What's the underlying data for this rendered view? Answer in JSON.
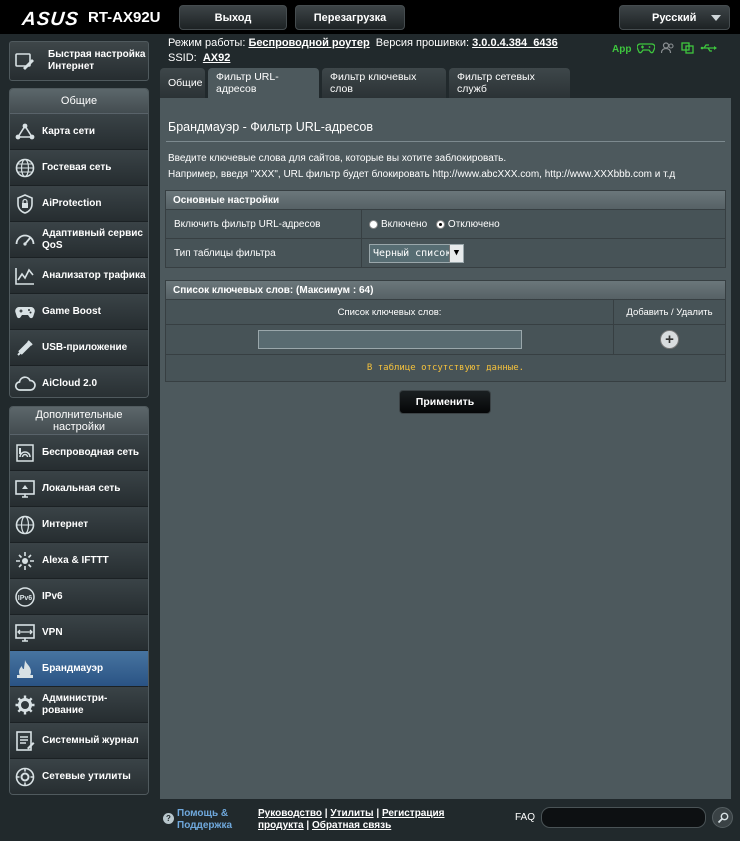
{
  "header": {
    "brand": "ASUS",
    "model": "RT-AX92U",
    "logout_label": "Выход",
    "reboot_label": "Перезагрузка",
    "language": "Русский"
  },
  "info": {
    "mode_label": "Режим работы:",
    "mode_value": "Беспроводной роутер",
    "firmware_label": "Версия прошивки:",
    "firmware_value": "3.0.0.4.384_6436",
    "ssid_label": "SSID:",
    "ssid_value": "AX92",
    "app_label": "App"
  },
  "sidebar": {
    "quick_setup": "Быстрая настройка Интернет",
    "general_header": "Общие",
    "general_items": [
      {
        "label": "Карта сети"
      },
      {
        "label": "Гостевая сеть"
      },
      {
        "label": "AiProtection"
      },
      {
        "label": "Адаптивный сервис QoS"
      },
      {
        "label": "Анализатор трафика"
      },
      {
        "label": "Game Boost"
      },
      {
        "label": "USB-приложение"
      },
      {
        "label": "AiCloud 2.0"
      }
    ],
    "advanced_header": "Дополнительные настройки",
    "advanced_items": [
      {
        "label": "Беспроводная сеть"
      },
      {
        "label": "Локальная сеть"
      },
      {
        "label": "Интернет"
      },
      {
        "label": "Alexa & IFTTT"
      },
      {
        "label": "IPv6"
      },
      {
        "label": "VPN"
      },
      {
        "label": "Брандмауэр"
      },
      {
        "label": "Администри-рование"
      },
      {
        "label": "Системный журнал"
      },
      {
        "label": "Сетевые утилиты"
      }
    ]
  },
  "tabs": [
    {
      "label": "Общие"
    },
    {
      "label": "Фильтр URL-адресов"
    },
    {
      "label": "Фильтр ключевых слов"
    },
    {
      "label": "Фильтр сетевых служб"
    }
  ],
  "main": {
    "title": "Брандмауэр - Фильтр URL-адресов",
    "desc1": "Введите ключевые слова для сайтов, которые вы хотите заблокировать.",
    "desc2": "Например, введя \"XXX\", URL фильтр будет блокировать http://www.abcXXX.com, http://www.XXXbbb.com и т.д",
    "basic_header": "Основные настройки",
    "enable_label": "Включить фильтр URL-адресов",
    "radio_on": "Включено",
    "radio_off": "Отключено",
    "table_type_label": "Тип таблицы фильтра",
    "table_type_value": "Черный список",
    "keyword_header": "Список ключевых слов: (Максимум : 64)",
    "col_keywords": "Список ключевых слов:",
    "col_add_remove": "Добавить / Удалить",
    "empty_text": "В таблице отсутствуют данные.",
    "apply_label": "Применить"
  },
  "footer": {
    "help_line1": "Помощь &",
    "help_line2": "Поддержка",
    "link_manual": "Руководство",
    "link_utilities": "Утилиты",
    "link_registration": "Регистрация",
    "link_product": "продукта",
    "link_feedback": "Обратная связь",
    "faq_label": "FAQ"
  },
  "colors": {
    "active_item": "#2a5384",
    "panel_bg": "#4d595d",
    "status_green": "#3ec63e",
    "empty_text": "#f5c23c"
  }
}
